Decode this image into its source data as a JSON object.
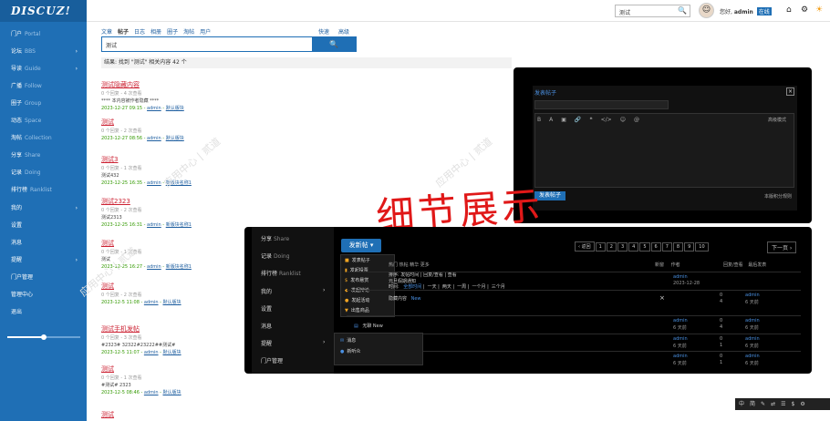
{
  "sidebar": {
    "logo": "DISCUZ!",
    "items": [
      {
        "label": "门户",
        "en": "Portal",
        "arrow": ""
      },
      {
        "label": "论坛",
        "en": "BBS",
        "arrow": "›"
      },
      {
        "label": "导读",
        "en": "Guide",
        "arrow": "›"
      },
      {
        "label": "广播",
        "en": "Follow",
        "arrow": ""
      },
      {
        "label": "圈子",
        "en": "Group",
        "arrow": ""
      },
      {
        "label": "动态",
        "en": "Space",
        "arrow": ""
      },
      {
        "label": "淘帖",
        "en": "Collection",
        "arrow": ""
      },
      {
        "label": "分享",
        "en": "Share",
        "arrow": ""
      },
      {
        "label": "记录",
        "en": "Doing",
        "arrow": ""
      },
      {
        "label": "排行榜",
        "en": "Ranklist",
        "arrow": ""
      },
      {
        "label": "我的",
        "en": "",
        "arrow": "›"
      },
      {
        "label": "设置",
        "en": "",
        "arrow": ""
      },
      {
        "label": "消息",
        "en": "",
        "arrow": ""
      },
      {
        "label": "提醒",
        "en": "",
        "arrow": "›"
      },
      {
        "label": "门户管理",
        "en": "",
        "arrow": ""
      },
      {
        "label": "管理中心",
        "en": "",
        "arrow": ""
      },
      {
        "label": "退出",
        "en": "",
        "arrow": ""
      }
    ],
    "slider_level": 0.5
  },
  "topbar": {
    "search_value": "测试",
    "search_icon": "search-icon",
    "greeting": "您好,",
    "username": "admin",
    "online": "在线",
    "icons": [
      "home-icon",
      "gear-icon",
      "sun-icon"
    ]
  },
  "search": {
    "tabs": [
      "文章",
      "帖子",
      "日志",
      "相册",
      "圈子",
      "淘帖",
      "用户"
    ],
    "active_tab": "帖子",
    "right_links": [
      "快速",
      "高级"
    ],
    "value": "测试",
    "button_icon": "search-icon",
    "result_summary": "结果: 找到 \"测试\" 相关内容 42 个"
  },
  "results": [
    {
      "title": "测试隐藏内容",
      "counts": "0 个回复 - 4 次查看",
      "excerpt": "**** 本内容被作者隐藏 ****",
      "date": "2023-12-27 09:15",
      "author": "admin",
      "forum": "默认版块"
    },
    {
      "title": "测试",
      "counts": "0 个回复 - 2 次查看",
      "excerpt": "",
      "date": "2023-12-27 08:56",
      "author": "admin",
      "forum": "默认版块"
    },
    {
      "title": "测试3",
      "counts": "0 个回复 - 1 次查看",
      "excerpt": "测试432",
      "date": "2023-12-25 16:35",
      "author": "admin",
      "forum": "新版块名称1"
    },
    {
      "title": "测试2323",
      "counts": "0 个回复 - 2 次查看",
      "excerpt": "测试2313",
      "date": "2023-12-25 16:31",
      "author": "admin",
      "forum": "新版块名称1"
    },
    {
      "title": "测试",
      "counts": "0 个回复 - 1 次查看",
      "excerpt": "测试",
      "date": "2023-12-25 16:27",
      "author": "admin",
      "forum": "新版块名称1"
    },
    {
      "title": "测试",
      "counts": "0 个回复 - 2 次查看",
      "excerpt": "",
      "date": "2023-12-5 11:08",
      "author": "admin",
      "forum": "默认版块"
    },
    {
      "title": "测试手机发帖",
      "counts": "0 个回复 - 3 次查看",
      "excerpt": "#2323# 32322#23222##测试#",
      "date": "2023-12-5 11:07",
      "author": "admin",
      "forum": "默认版块"
    },
    {
      "title": "测试",
      "counts": "0 个回复 - 1 次查看",
      "excerpt": "#测试# 2323",
      "date": "2023-12-5 08:46",
      "author": "admin",
      "forum": "默认版块"
    },
    {
      "title": "测试",
      "counts": "",
      "excerpt": "",
      "date": "",
      "author": "",
      "forum": ""
    }
  ],
  "watermark": "应用中心 | 贰道",
  "editor": {
    "title": "发表帖子",
    "tools": [
      "B",
      "A",
      "▣",
      "🔗",
      "❝",
      "</>",
      "☺",
      "@"
    ],
    "advanced": "高级模式",
    "post_button": "发表帖子",
    "rules": "本版积分规则"
  },
  "handwriting": "细节展示",
  "detail": {
    "sidebar": [
      {
        "label": "分享",
        "en": "Share"
      },
      {
        "label": "记录",
        "en": "Doing"
      },
      {
        "label": "排行榜",
        "en": "Ranklist"
      },
      {
        "label": "我的",
        "en": "",
        "arrow": "›"
      },
      {
        "label": "设置",
        "en": ""
      },
      {
        "label": "消息",
        "en": ""
      },
      {
        "label": "提醒",
        "en": "",
        "arrow": "›"
      },
      {
        "label": "门户管理",
        "en": ""
      }
    ],
    "new_button": "发新帖 ▾",
    "menu": [
      {
        "icon": "■",
        "label": "发表帖子"
      },
      {
        "icon": "▮",
        "label": "发起投票"
      },
      {
        "icon": "$",
        "label": "发布悬赏"
      },
      {
        "icon": "◆",
        "label": "发起辩论"
      },
      {
        "icon": "●",
        "label": "发起活动"
      },
      {
        "icon": "▼",
        "label": "出售商品"
      }
    ],
    "filter1": "排序: 发帖时间 | 回复/查看 | 查看",
    "filter2_label": "时间:",
    "filter2": [
      "全部时间",
      "一天",
      "两天",
      "一周",
      "一个月",
      "三个月"
    ],
    "hidden_text": "隐藏内容",
    "new_badge": "New",
    "tabs_text": "热门  热帖  精华  更多",
    "pager": [
      "‹ 返回",
      "1",
      "2",
      "3",
      "4",
      "5",
      "6",
      "7",
      "8",
      "9",
      "10"
    ],
    "pager_next": "下一页 ›",
    "head_new": "新窗",
    "head_author": "作者",
    "head_stats": "回复/查看",
    "head_last": "最后发表",
    "rows": [
      {
        "author": "admin",
        "date": "2023-12-28",
        "n1": "",
        "n2": "",
        "last": "",
        "last_date": ""
      },
      {
        "author": "",
        "date": "",
        "n1": "0",
        "n2": "4",
        "last": "admin",
        "last_date": "6 天前"
      },
      {
        "author": "admin",
        "date": "6 天前",
        "n1": "0",
        "n2": "4",
        "last": "admin",
        "last_date": "6 天前"
      },
      {
        "author": "admin",
        "date": "6 天前",
        "n1": "0",
        "n2": "1",
        "last": "admin",
        "last_date": "6 天前"
      },
      {
        "author": "admin",
        "date": "6 天前",
        "n1": "0",
        "n2": "1",
        "last": "admin",
        "last_date": "6 天前"
      }
    ],
    "sub_menu": [
      {
        "icon": "✉",
        "label": "消息"
      },
      {
        "icon": "●",
        "label": "新听众"
      }
    ],
    "stub1": "无聊 New",
    "stub2": "元旦假期通知"
  },
  "minibar": [
    "中",
    "简",
    "✎",
    "⇄",
    "☰",
    "$",
    "⚙"
  ]
}
